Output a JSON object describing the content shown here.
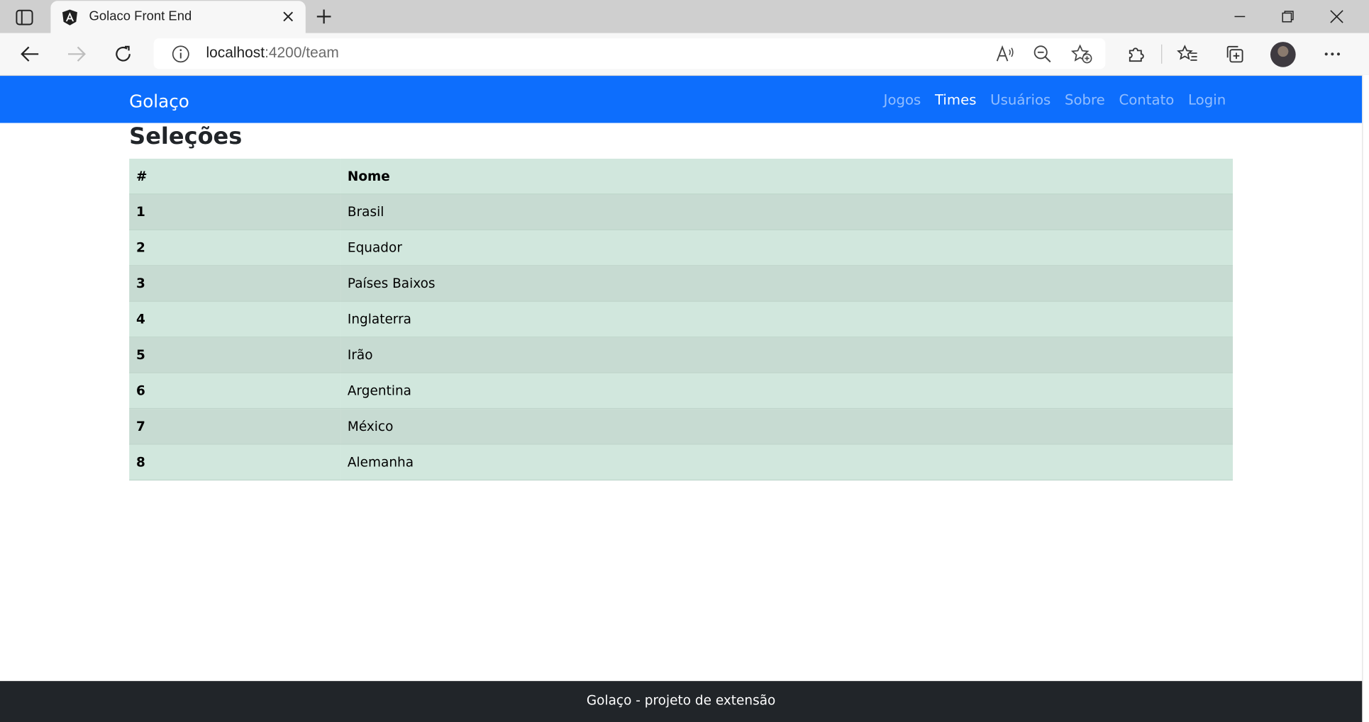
{
  "browser": {
    "tab_title": "Golaco Front End",
    "url_host": "localhost",
    "url_path": ":4200/team",
    "icons": [
      "sidebar-icon",
      "angular-icon",
      "close-icon",
      "plus-icon",
      "minimize-icon",
      "restore-icon",
      "window-close-icon",
      "back-icon",
      "forward-icon",
      "refresh-icon",
      "info-icon",
      "read-aloud-icon",
      "zoom-out-icon",
      "add-favorite-icon",
      "extensions-icon",
      "favorites-icon",
      "collections-icon",
      "profile-avatar",
      "more-icon"
    ]
  },
  "navbar": {
    "brand": "Golaço",
    "links": [
      {
        "label": "Jogos",
        "active": false
      },
      {
        "label": "Times",
        "active": true
      },
      {
        "label": "Usuários",
        "active": false
      },
      {
        "label": "Sobre",
        "active": false
      },
      {
        "label": "Contato",
        "active": false
      },
      {
        "label": "Login",
        "active": false
      }
    ],
    "color": "#0d6efd"
  },
  "page": {
    "title": "Seleções",
    "table": {
      "headers": [
        "#",
        "Nome"
      ],
      "rows": [
        {
          "id": "1",
          "name": "Brasil"
        },
        {
          "id": "2",
          "name": "Equador"
        },
        {
          "id": "3",
          "name": "Países Baixos"
        },
        {
          "id": "4",
          "name": "Inglaterra"
        },
        {
          "id": "5",
          "name": "Irão"
        },
        {
          "id": "6",
          "name": "Argentina"
        },
        {
          "id": "7",
          "name": "México"
        },
        {
          "id": "8",
          "name": "Alemanha"
        }
      ],
      "row_color": "#d1e7dd"
    }
  },
  "footer": {
    "text": "Golaço - projeto de extensão",
    "color": "#212529"
  }
}
